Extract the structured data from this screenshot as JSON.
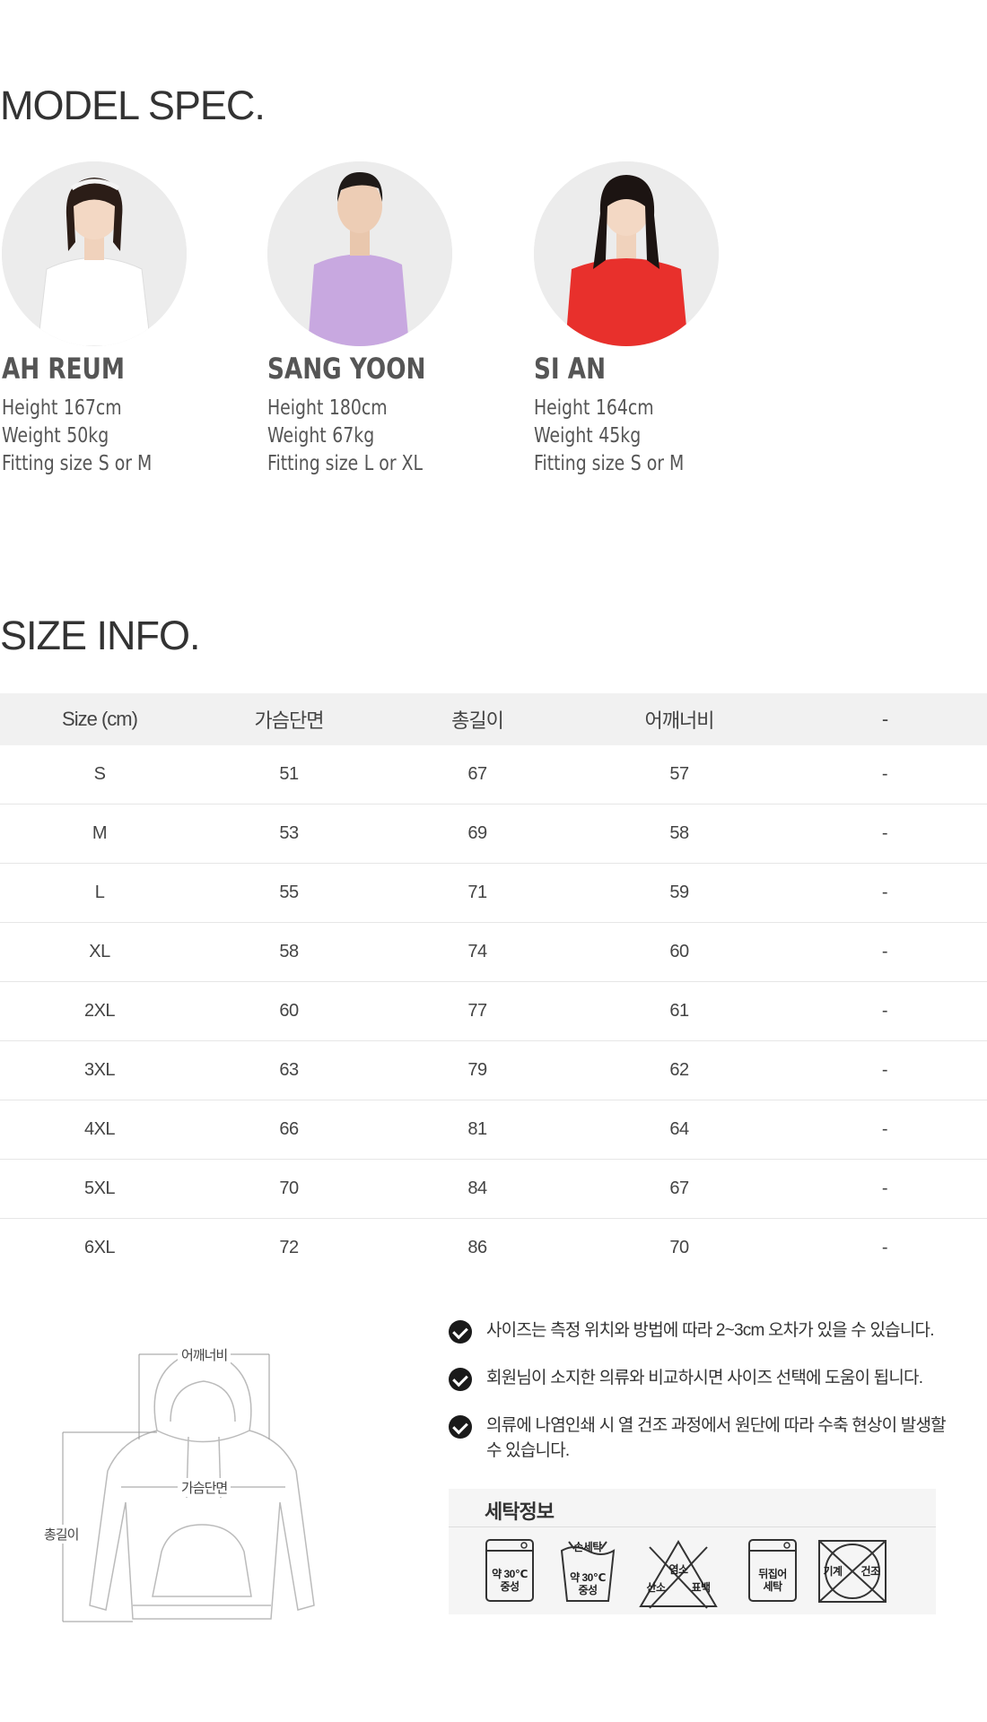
{
  "model_spec": {
    "title": "MODEL SPEC.",
    "models": [
      {
        "name": "AH REUM",
        "height_label": "Height",
        "height": "167cm",
        "weight_label": "Weight",
        "weight": "50kg",
        "fit_label": "Fitting size",
        "fit": "S or M",
        "shirt_color": "#ffffff"
      },
      {
        "name": "SANG YOON",
        "height_label": "Height",
        "height": "180cm",
        "weight_label": "Weight",
        "weight": "67kg",
        "fit_label": "Fitting size",
        "fit": "L or XL",
        "shirt_color": "#c8a8e0"
      },
      {
        "name": "SI AN",
        "height_label": "Height",
        "height": "164cm",
        "weight_label": "Weight",
        "weight": "45kg",
        "fit_label": "Fitting size",
        "fit": "S or M",
        "shirt_color": "#e8302c"
      }
    ]
  },
  "size_info": {
    "title": "SIZE INFO.",
    "headers": [
      "Size (cm)",
      "가슴단면",
      "총길이",
      "어깨너비",
      "-"
    ],
    "rows": [
      [
        "S",
        "51",
        "67",
        "57",
        "-"
      ],
      [
        "M",
        "53",
        "69",
        "58",
        "-"
      ],
      [
        "L",
        "55",
        "71",
        "59",
        "-"
      ],
      [
        "XL",
        "58",
        "74",
        "60",
        "-"
      ],
      [
        "2XL",
        "60",
        "77",
        "61",
        "-"
      ],
      [
        "3XL",
        "63",
        "79",
        "62",
        "-"
      ],
      [
        "4XL",
        "66",
        "81",
        "64",
        "-"
      ],
      [
        "5XL",
        "70",
        "84",
        "67",
        "-"
      ],
      [
        "6XL",
        "72",
        "86",
        "70",
        "-"
      ]
    ]
  },
  "diagram": {
    "shoulder_label": "어깨너비",
    "chest_label": "가슴단면",
    "length_label": "총길이"
  },
  "notes": [
    "사이즈는 측정 위치와 방법에 따라 2~3cm 오차가 있을 수 있습니다.",
    "회원님이 소지한 의류와 비교하시면 사이즈 선택에 도움이 됩니다.",
    "의류에 나염인쇄 시 열 건조 과정에서 원단에 따라 수축 현상이 발생할 수 있습니다."
  ],
  "care": {
    "title": "세탁정보",
    "icons": [
      {
        "name": "machine-wash",
        "line1": "약 30℃",
        "line2": "중성"
      },
      {
        "name": "hand-wash",
        "top": "손세탁",
        "line1": "약 30℃",
        "line2": "중성"
      },
      {
        "name": "no-bleach",
        "line1": "염소",
        "line2": "산소",
        "line3": "표백"
      },
      {
        "name": "inside-out",
        "line1": "뒤집어",
        "line2": "세탁"
      },
      {
        "name": "no-machine-dry",
        "line1": "기계",
        "line2": "건조"
      }
    ]
  }
}
